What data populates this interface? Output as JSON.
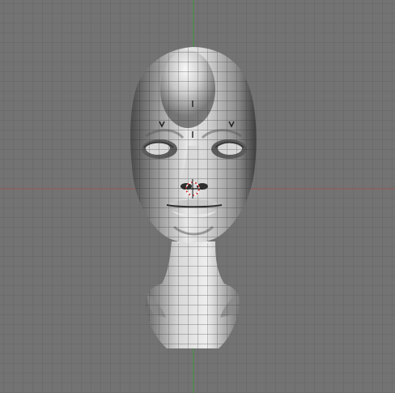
{
  "viewport": {
    "view": "front",
    "colors": {
      "background": "#737373",
      "grid_line": "#666666",
      "x_axis": "#a05a5a",
      "y_axis": "#3c9a3c",
      "mesh_wire": "#2a2a2a",
      "surface_light": "#f2f2f2",
      "surface_dark": "#3a3a3a",
      "cursor_red": "#d02020"
    },
    "model": {
      "kind": "sculpted-head-bust",
      "shading": "solid-with-wireframe"
    },
    "cursor": {
      "icon": "3d-cursor-icon"
    }
  }
}
